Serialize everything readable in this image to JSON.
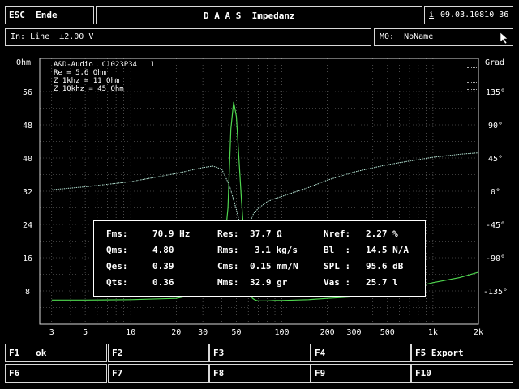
{
  "header": {
    "esc_label": "ESC  Ende",
    "title": "D A A S  Impedanz",
    "info_icon": "i",
    "datetime": "09.03.10810 36",
    "input_label": "In: Line  ±2.00 V",
    "memory_label": "M0:  NoName"
  },
  "left_axis": {
    "unit": "Ohm",
    "ticks": [
      "56",
      "48",
      "40",
      "32",
      "24",
      "16",
      "8"
    ]
  },
  "right_axis": {
    "unit": "Grad",
    "ticks": [
      "135°",
      "90°",
      "45°",
      "0°",
      "-45°",
      "-90°",
      "-135°"
    ]
  },
  "x_axis": {
    "ticks": [
      "3",
      "5",
      "10",
      "20",
      "30",
      "50",
      "100",
      "200",
      "300",
      "500",
      "1k",
      "2k"
    ]
  },
  "info": {
    "line1": "A&D-Audio  C1023P34   1",
    "line2": "Re = 5,6 Ohm",
    "line3": "Z 1khz = 11 Ohm",
    "line4": "Z 10khz = 45 Ohm"
  },
  "params": {
    "r1": {
      "k1": "Fms:",
      "v1": "70.9 Hz",
      "k2": "Res:",
      "v2": "37.7 Ω",
      "k3": "Nref:",
      "v3": "2.27 %"
    },
    "r2": {
      "k1": "Qms:",
      "v1": "4.80",
      "k2": "Rms:",
      "v2": "3.1 kg/s",
      "k3": "Bl  :",
      "v3": "14.5 N/A"
    },
    "r3": {
      "k1": "Qes:",
      "v1": "0.39",
      "k2": "Cms:",
      "v2": "0.15 mm/N",
      "k3": "SPL :",
      "v3": "95.6 dB"
    },
    "r4": {
      "k1": "Qts:",
      "v1": "0.36",
      "k2": "Mms:",
      "v2": "32.9 gr",
      "k3": "Vas :",
      "v3": "25.7 l"
    }
  },
  "fkeys": {
    "f1": "F1   ok",
    "f2": "F2",
    "f3": "F3",
    "f4": "F4",
    "f5": "F5 Export",
    "f6": "F6",
    "f7": "F7",
    "f8": "F8",
    "f9": "F9",
    "f10": "F10"
  },
  "colors": {
    "impedance": "#4fd64f",
    "phase": "#b8e8d8",
    "grid": "#7a7a7a",
    "frame": "#d8d8d8"
  },
  "chart_data": {
    "type": "line",
    "x_scale": "log",
    "xlim": [
      2.5,
      2000
    ],
    "ylim_left": [
      0,
      64
    ],
    "ylim_right": [
      -180,
      180
    ],
    "series": [
      {
        "axis": "left",
        "x": [
          3,
          5,
          10,
          20,
          30,
          40,
          44,
          46,
          48,
          50,
          52,
          54,
          56,
          58,
          60,
          62,
          64,
          66,
          68,
          70,
          75,
          80,
          90,
          100,
          150,
          200,
          300,
          500,
          700,
          1000,
          1500,
          2000
        ],
        "y": [
          5.8,
          5.8,
          5.9,
          6.2,
          7.5,
          12,
          28,
          47,
          53.5,
          50,
          40,
          30,
          22,
          14,
          10,
          7,
          6.2,
          5.9,
          5.7,
          5.6,
          5.6,
          5.6,
          5.7,
          5.7,
          5.9,
          6.2,
          6.6,
          7.6,
          8.6,
          10,
          11.2,
          12.5
        ]
      },
      {
        "axis": "right",
        "x": [
          3,
          5,
          10,
          20,
          30,
          35,
          40,
          45,
          50,
          55,
          60,
          65,
          70,
          80,
          90,
          100,
          150,
          200,
          300,
          500,
          1000,
          1500,
          2000
        ],
        "y": [
          2,
          6,
          13,
          24,
          32,
          34,
          30,
          8,
          -25,
          -60,
          -48,
          -30,
          -23,
          -14,
          -10,
          -7,
          5,
          15,
          26,
          36,
          46,
          50,
          52
        ]
      }
    ]
  }
}
